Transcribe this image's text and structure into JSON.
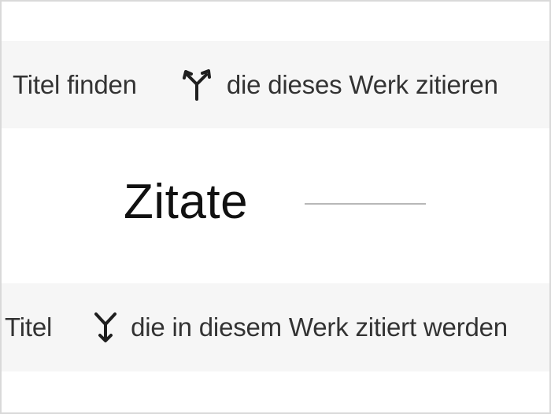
{
  "citations": {
    "cited_by": {
      "label": "Titel finden",
      "icon": "fork-up-icon",
      "description": "die dieses Werk zitieren"
    },
    "heading": "Zitate",
    "references": {
      "label": "Titel",
      "icon": "merge-down-icon",
      "description": "die in diesem Werk zitiert werden"
    }
  }
}
